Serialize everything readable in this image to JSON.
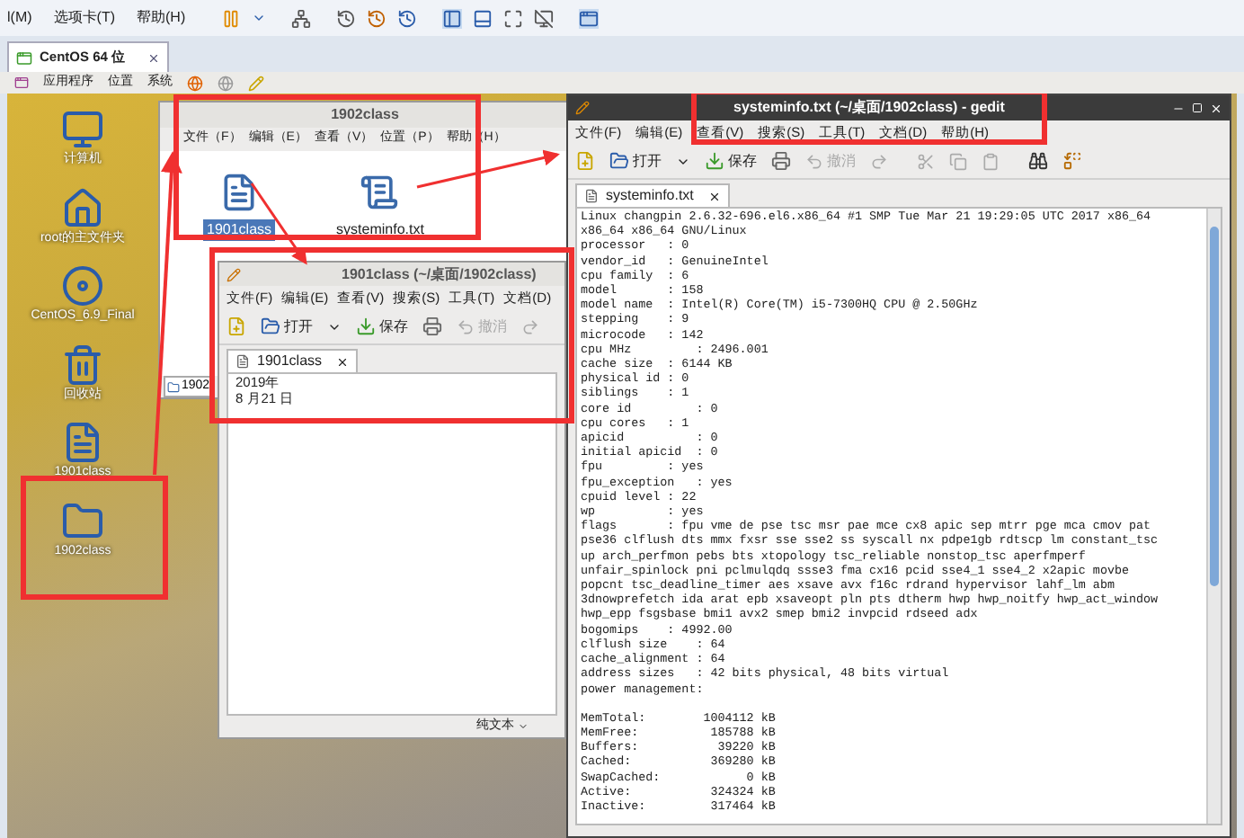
{
  "vm_menu": [
    "l(M)",
    "选项卡(T)",
    "帮助(H)"
  ],
  "vm_tabs": [
    {
      "label": "CentOS 64 位",
      "selected": true
    }
  ],
  "guest_panel": {
    "menus": [
      "应用程序",
      "位置",
      "系统"
    ]
  },
  "desktop_icons": [
    {
      "label": "计算机",
      "kind": "computer"
    },
    {
      "label": "root的主文件夹",
      "kind": "home"
    },
    {
      "label": "CentOS_6.9_Final",
      "kind": "disc"
    },
    {
      "label": "回收站",
      "kind": "trash"
    },
    {
      "label": "1901class",
      "kind": "document"
    },
    {
      "label": "1902class",
      "kind": "folder"
    }
  ],
  "file_manager": {
    "title": "1902class",
    "menus": [
      "文件（F）",
      "编辑（E）",
      "查看（V）",
      "位置（P）",
      "帮助（H）"
    ],
    "files": [
      {
        "name": "1901class",
        "kind": "document",
        "selected": true
      },
      {
        "name": "systeminfo.txt",
        "kind": "text",
        "selected": false
      }
    ],
    "location": "1902"
  },
  "small_editor": {
    "title": "1901class (~/桌面/1902class)",
    "menus": [
      "文件(F)",
      "编辑(E)",
      "查看(V)",
      "搜索(S)",
      "工具(T)",
      "文档(D)"
    ],
    "toolbar": [
      "打开",
      "保存",
      "撤消"
    ],
    "tab": "1901class",
    "lines": [
      "2019年",
      "8 月21 日"
    ],
    "status": "纯文本"
  },
  "main_editor": {
    "title": "systeminfo.txt (~/桌面/1902class) - gedit",
    "menus": [
      "文件(F)",
      "编辑(E)",
      "查看(V)",
      "搜索(S)",
      "工具(T)",
      "文档(D)",
      "帮助(H)"
    ],
    "toolbar": [
      "打开",
      "保存",
      "撤消"
    ],
    "tab": "systeminfo.txt",
    "blocks": [
      [
        "Linux changpin 2.6.32-696.el6.x86_64 #1 SMP Tue Mar 21 19:29:05 UTC 2017 x86_64",
        "x86_64 x86_64 GNU/Linux",
        "processor   : 0",
        "vendor_id   : GenuineIntel",
        "cpu family  : 6",
        "model       : 158",
        "model name  : Intel(R) Core(TM) i5-7300HQ CPU @ 2.50GHz",
        "stepping    : 9",
        "microcode   : 142",
        "cpu MHz         : 2496.001",
        "cache size  : 6144 KB",
        "physical id : 0",
        "siblings    : 1",
        "core id         : 0",
        "cpu cores   : 1",
        "apicid          : 0",
        "initial apicid  : 0",
        "fpu         : yes",
        "fpu_exception   : yes",
        "cpuid level : 22",
        "wp          : yes",
        "flags       : fpu vme de pse tsc msr pae mce cx8 apic sep mtrr pge mca cmov pat",
        "pse36 clflush dts mmx fxsr sse sse2 ss syscall nx pdpe1gb rdtscp lm constant_tsc",
        "up arch_perfmon pebs bts xtopology tsc_reliable nonstop_tsc aperfmperf",
        "unfair_spinlock pni pclmulqdq ssse3 fma cx16 pcid sse4_1 sse4_2 x2apic movbe",
        "popcnt tsc_deadline_timer aes xsave avx f16c rdrand hypervisor lahf_lm abm",
        "3dnowprefetch ida arat epb xsaveopt pln pts dtherm hwp hwp_noitfy hwp_act_window",
        "hwp_epp fsgsbase bmi1 avx2 smep bmi2 invpcid rdseed adx",
        "bogomips    : 4992.00",
        "clflush size    : 64",
        "cache_alignment : 64",
        "address sizes   : 42 bits physical, 48 bits virtual",
        "power management:"
      ],
      [
        "MemTotal:        1004112 kB",
        "MemFree:          185788 kB",
        "Buffers:           39220 kB",
        "Cached:           369280 kB",
        "SwapCached:            0 kB",
        "Active:           324324 kB",
        "Inactive:         317464 kB"
      ]
    ]
  }
}
